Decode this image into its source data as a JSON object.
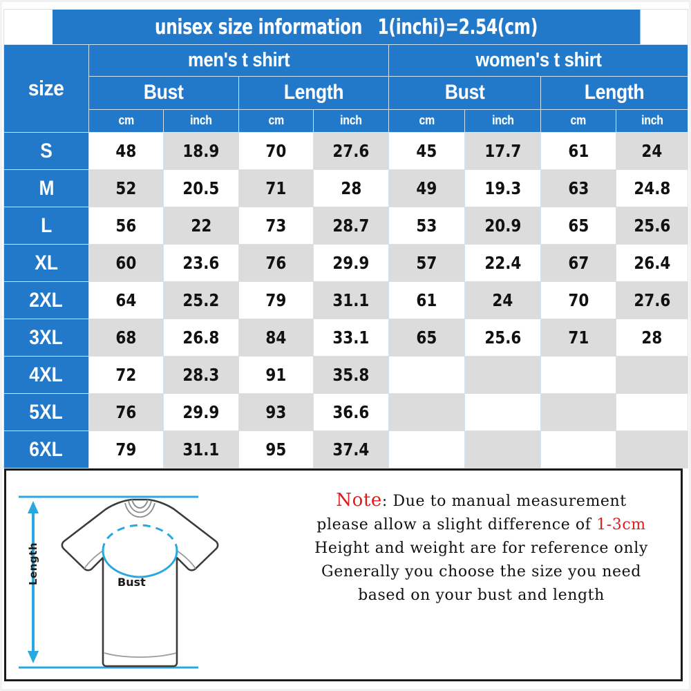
{
  "table": {
    "title_main": "unisex size information",
    "title_conv": "1(inchi)=2.54(cm)",
    "size_header": "size",
    "groups": [
      {
        "label": "men's t shirt"
      },
      {
        "label": "women's t shirt"
      }
    ],
    "measure_headers": [
      "Bust",
      "Length",
      "Bust",
      "Length"
    ],
    "unit_headers": [
      "cm",
      "inch",
      "cm",
      "inch",
      "cm",
      "inch",
      "cm",
      "inch"
    ],
    "rows": [
      {
        "size": "S",
        "values": [
          "48",
          "18.9",
          "70",
          "27.6",
          "45",
          "17.7",
          "61",
          "24"
        ]
      },
      {
        "size": "M",
        "values": [
          "52",
          "20.5",
          "71",
          "28",
          "49",
          "19.3",
          "63",
          "24.8"
        ]
      },
      {
        "size": "L",
        "values": [
          "56",
          "22",
          "73",
          "28.7",
          "53",
          "20.9",
          "65",
          "25.6"
        ]
      },
      {
        "size": "XL",
        "values": [
          "60",
          "23.6",
          "76",
          "29.9",
          "57",
          "22.4",
          "67",
          "26.4"
        ]
      },
      {
        "size": "2XL",
        "values": [
          "64",
          "25.2",
          "79",
          "31.1",
          "61",
          "24",
          "70",
          "27.6"
        ]
      },
      {
        "size": "3XL",
        "values": [
          "68",
          "26.8",
          "84",
          "33.1",
          "65",
          "25.6",
          "71",
          "28"
        ]
      },
      {
        "size": "4XL",
        "values": [
          "72",
          "28.3",
          "91",
          "35.8",
          "",
          "",
          "",
          ""
        ]
      },
      {
        "size": "5XL",
        "values": [
          "76",
          "29.9",
          "93",
          "36.6",
          "",
          "",
          "",
          ""
        ]
      },
      {
        "size": "6XL",
        "values": [
          "79",
          "31.1",
          "95",
          "37.4",
          "",
          "",
          "",
          ""
        ]
      }
    ]
  },
  "diagram": {
    "length_label": "Length",
    "bust_label": "Bust"
  },
  "note": {
    "keyword": "Note",
    "line1_rest": ": Due to manual measurement",
    "line2_a": "please allow a slight difference of ",
    "line2_highlight": "1-3cm",
    "line3": "Height and weight are for reference only",
    "line4": "Generally you choose the size you need",
    "line5": "based on your bust and length"
  },
  "colors": {
    "header_blue": "#2279c9",
    "cell_gray": "#dcdcdc",
    "cell_white": "#ffffff",
    "note_red": "#e01b1b",
    "arrow_blue": "#29a8e0",
    "panel_border": "#1a1a1a"
  }
}
